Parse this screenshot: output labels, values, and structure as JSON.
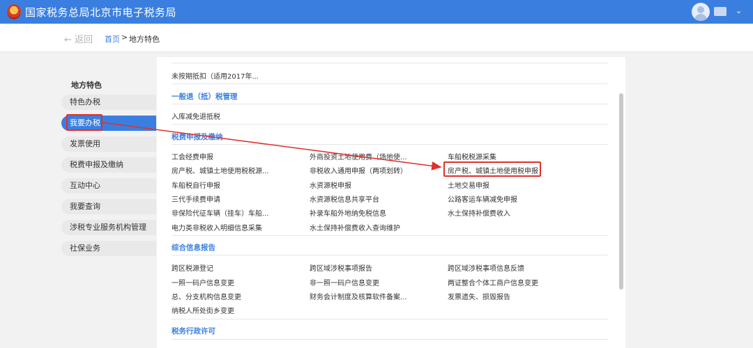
{
  "header": {
    "title": "国家税务总局北京市电子税务局",
    "user_caret": "⌄"
  },
  "breadcrumb": {
    "back_label": "← 返回",
    "home_label": "首页",
    "separator": ">",
    "current_label": "地方特色"
  },
  "sidebar": {
    "title": "地方特色",
    "items": [
      {
        "label": "特色办税",
        "active": false
      },
      {
        "label": "我要办税",
        "active": true
      },
      {
        "label": "发票使用",
        "active": false
      },
      {
        "label": "税费申报及缴纳",
        "active": false
      },
      {
        "label": "互动中心",
        "active": false
      },
      {
        "label": "我要查询",
        "active": false
      },
      {
        "label": "涉税专业服务机构管理",
        "active": false
      },
      {
        "label": "社保业务",
        "active": false
      }
    ]
  },
  "content": {
    "top_item": "未按期抵扣（适用2017年...",
    "sections": [
      {
        "title": "一般退（抵）税管理",
        "items": [
          "入库减免退抵税"
        ]
      },
      {
        "title": "税费申报及缴纳",
        "items": [
          "工会经费申报",
          "外商投资土地使用费（场地使...",
          "车船税税源采集",
          "房产税、城镇土地使用税税源...",
          "非税收入通用申报（两项划转）",
          "房产税、城镇土地使用税申报",
          "车船税自行申报",
          "水资源税申报",
          "土地交易申报",
          "三代手续费申请",
          "水资源税信息共享平台",
          "公路客运车辆减免申报",
          "非保险代征车辆（挂车）车船...",
          "补录车船外地纳免税信息",
          "水土保持补偿费收入",
          "电力类非税收入明细信息采集",
          "水土保持补偿费收入查询维护"
        ]
      },
      {
        "title": "综合信息报告",
        "items": [
          "跨区税源登记",
          "跨区域涉税事项报告",
          "跨区域涉税事项信息反馈",
          "一照一码户信息变更",
          "非一照一码户信息变更",
          "两证整合个体工商户信息变更",
          "总、分支机构信息变更",
          "财务会计制度及核算软件备案...",
          "发票遗失、损毁报告",
          "纳税人所处街乡变更"
        ]
      },
      {
        "title": "税务行政许可",
        "items": []
      }
    ]
  },
  "colors": {
    "accent": "#3a7fe0",
    "highlight": "#e0302a"
  }
}
